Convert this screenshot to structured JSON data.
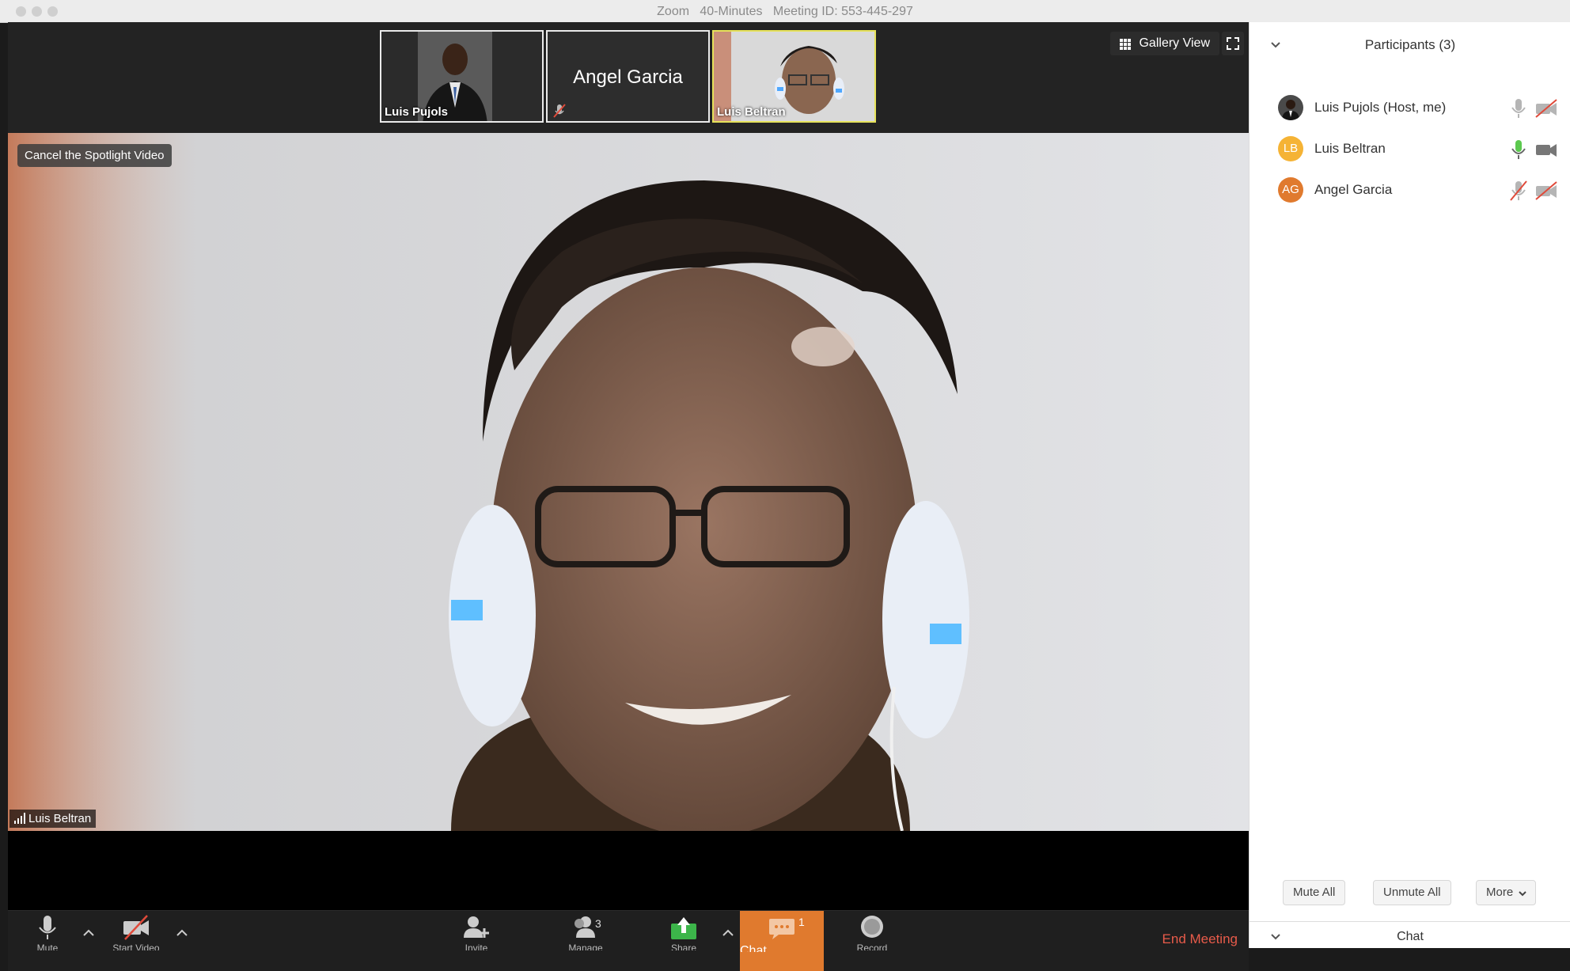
{
  "window": {
    "title": "Zoom   40-Minutes   Meeting ID: 553-445-297"
  },
  "thumbnails": [
    {
      "name": "Luis Pujols",
      "type": "video"
    },
    {
      "name": "Angel Garcia",
      "type": "name"
    },
    {
      "name": "Luis Beltran",
      "type": "video"
    }
  ],
  "gallery_view_label": "Gallery View",
  "spotlight": {
    "cancel_label": "Cancel the Spotlight Video",
    "speaker_name": "Luis Beltran"
  },
  "toolbar": {
    "mute_label": "Mute",
    "video_label": "Start Video",
    "invite_label": "Invite",
    "manage_label": "Manage Participants",
    "participants_count": "3",
    "share_label": "Share",
    "chat_label": "Chat",
    "chat_badge": "1",
    "record_label": "Record",
    "end_label": "End Meeting"
  },
  "participants": {
    "title": "Participants (3)",
    "list": [
      {
        "name": "Luis Pujols (Host, me)",
        "initials": "",
        "avatar_color": "#4a4a4a",
        "mic": "off",
        "camera": "off"
      },
      {
        "name": "Luis Beltran",
        "initials": "LB",
        "avatar_color": "#f5b335",
        "mic": "on",
        "camera": "on"
      },
      {
        "name": "Angel Garcia",
        "initials": "AG",
        "avatar_color": "#e07a2e",
        "mic": "muted",
        "camera": "off"
      }
    ],
    "mute_all": "Mute All",
    "unmute_all": "Unmute All",
    "more": "More"
  },
  "chat_panel": {
    "title": "Chat"
  },
  "colors": {
    "accent": "#e07a2e",
    "end": "#e85b4a",
    "active_border": "#e6e25a",
    "mic_on": "#5cc94f"
  }
}
